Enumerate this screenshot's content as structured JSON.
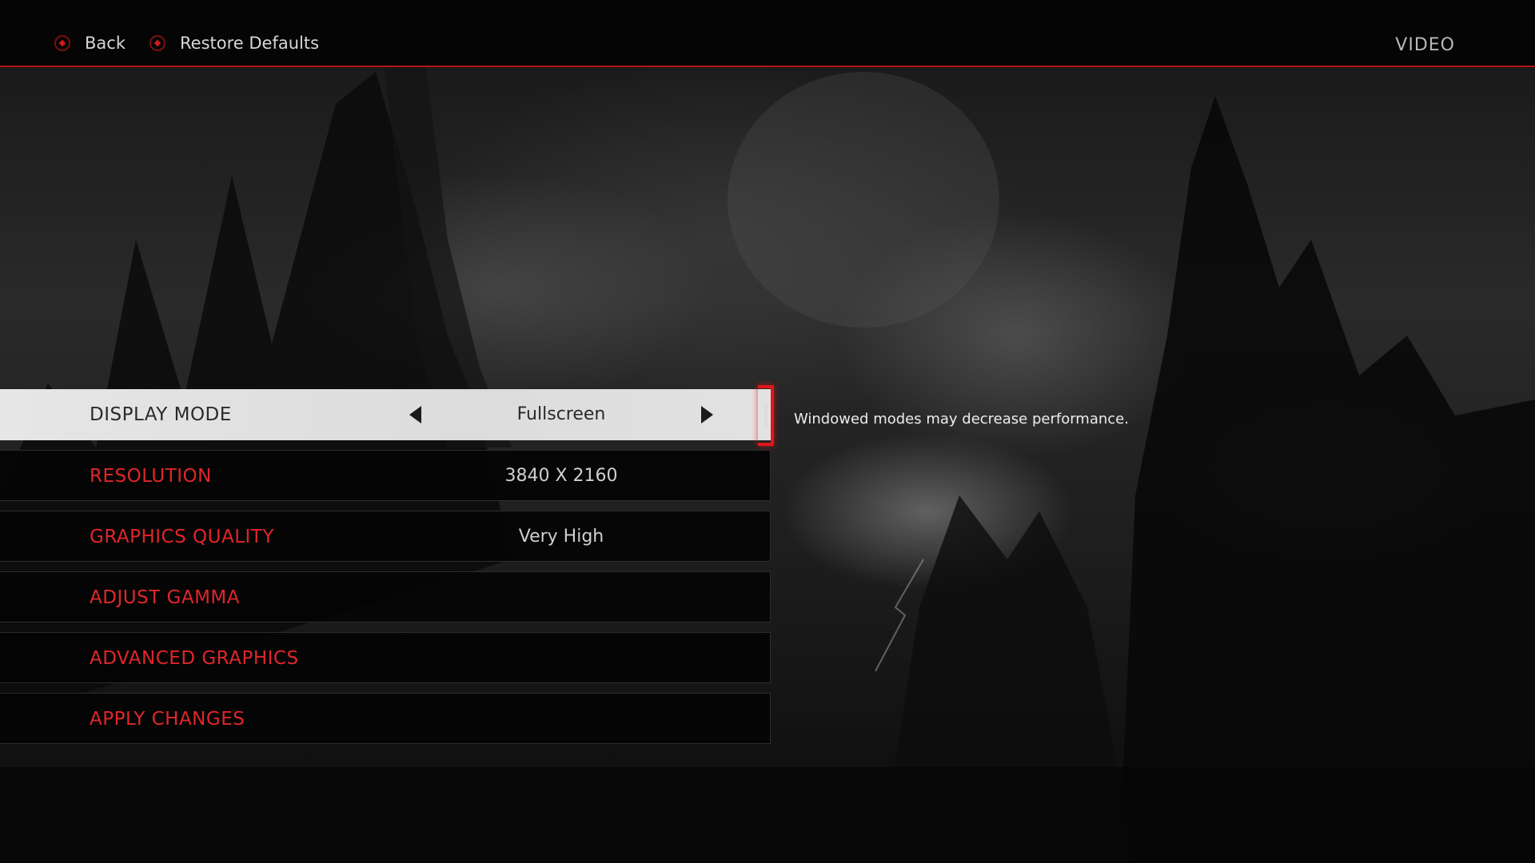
{
  "topbar": {
    "back_label": "Back",
    "restore_label": "Restore Defaults",
    "screen_title": "VIDEO",
    "accent_color": "#b01515"
  },
  "menu": {
    "items": [
      {
        "label": "DISPLAY MODE",
        "value": "Fullscreen",
        "selected": true
      },
      {
        "label": "RESOLUTION",
        "value": "3840 X 2160"
      },
      {
        "label": "GRAPHICS QUALITY",
        "value": "Very High"
      },
      {
        "label": "ADJUST GAMMA",
        "value": ""
      },
      {
        "label": "ADVANCED GRAPHICS",
        "value": ""
      },
      {
        "label": "APPLY CHANGES",
        "value": ""
      }
    ]
  },
  "hint": {
    "text": "Windowed modes may decrease performance."
  },
  "icons": {
    "back": "b-button-icon",
    "restore": "b-button-icon",
    "prev": "left-arrow-icon",
    "next": "right-arrow-icon"
  }
}
